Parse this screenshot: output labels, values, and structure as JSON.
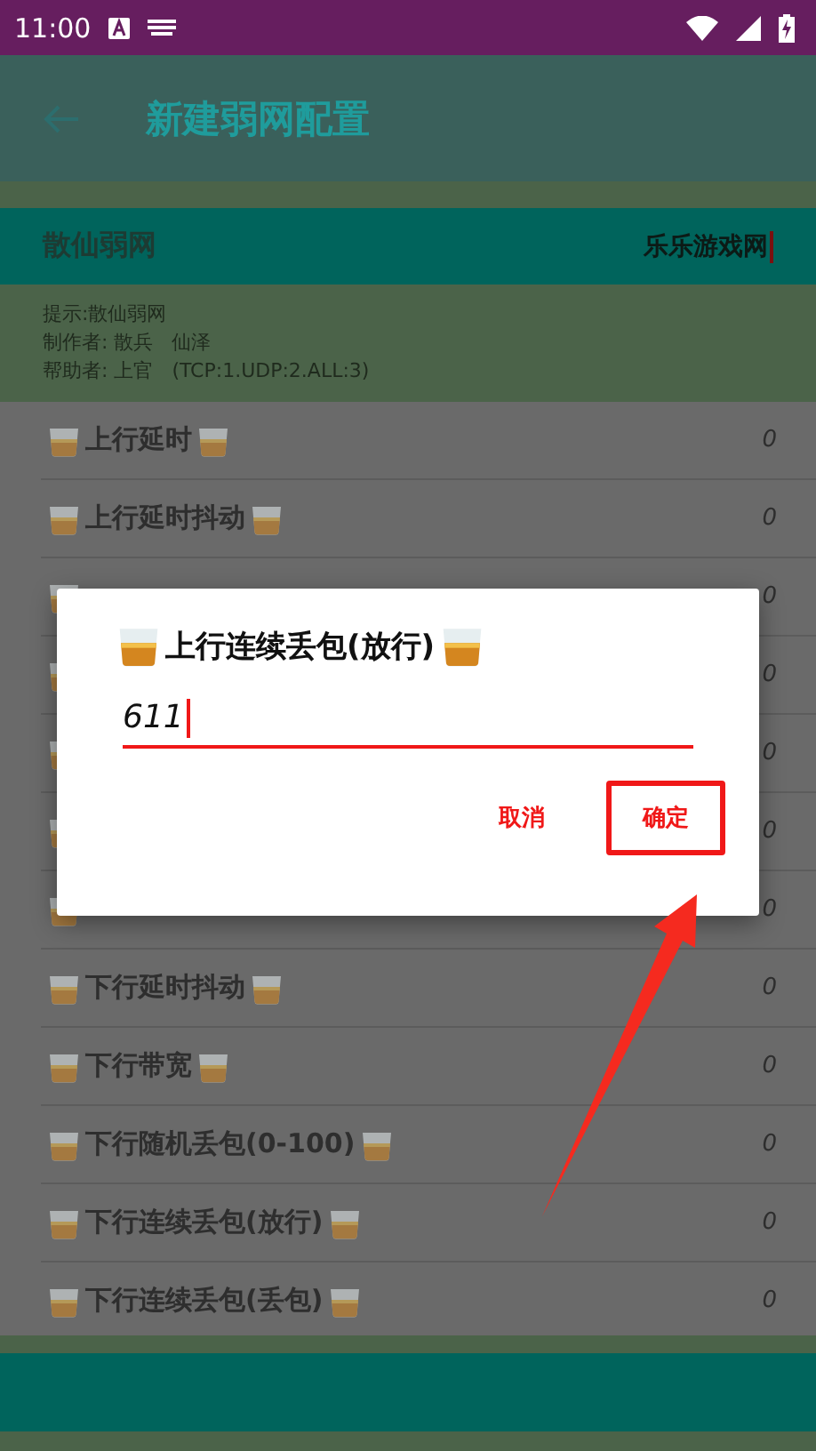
{
  "status_bar": {
    "time": "11:00"
  },
  "app_bar": {
    "title": "新建弱网配置"
  },
  "profile": {
    "name": "散仙弱网",
    "value": "乐乐游戏网"
  },
  "info": [
    "提示:散仙弱网",
    "制作者: 散兵   仙泽",
    "帮助者: 上官   (TCP:1.UDP:2.ALL:3)"
  ],
  "rows": [
    {
      "label": "上行延时",
      "value": "0"
    },
    {
      "label": "上行延时抖动",
      "value": "0"
    },
    {
      "value": "0"
    },
    {
      "value": "0"
    },
    {
      "value": "0"
    },
    {
      "value": "0"
    },
    {
      "value": "0"
    },
    {
      "label": "下行延时抖动",
      "value": "0"
    },
    {
      "label": "下行带宽",
      "value": "0"
    },
    {
      "label": "下行随机丢包(0-100)",
      "value": "0"
    },
    {
      "label": "下行连续丢包(放行)",
      "value": "0"
    },
    {
      "label": "下行连续丢包(丢包)",
      "value": "0"
    }
  ],
  "dialog": {
    "title": "上行连续丢包(放行)",
    "value": "611",
    "buttons": [
      {
        "label": "取消",
        "highlighted": false
      },
      {
        "label": "确定",
        "highlighted": true
      }
    ]
  },
  "annotation": {
    "kind": "arrow"
  }
}
